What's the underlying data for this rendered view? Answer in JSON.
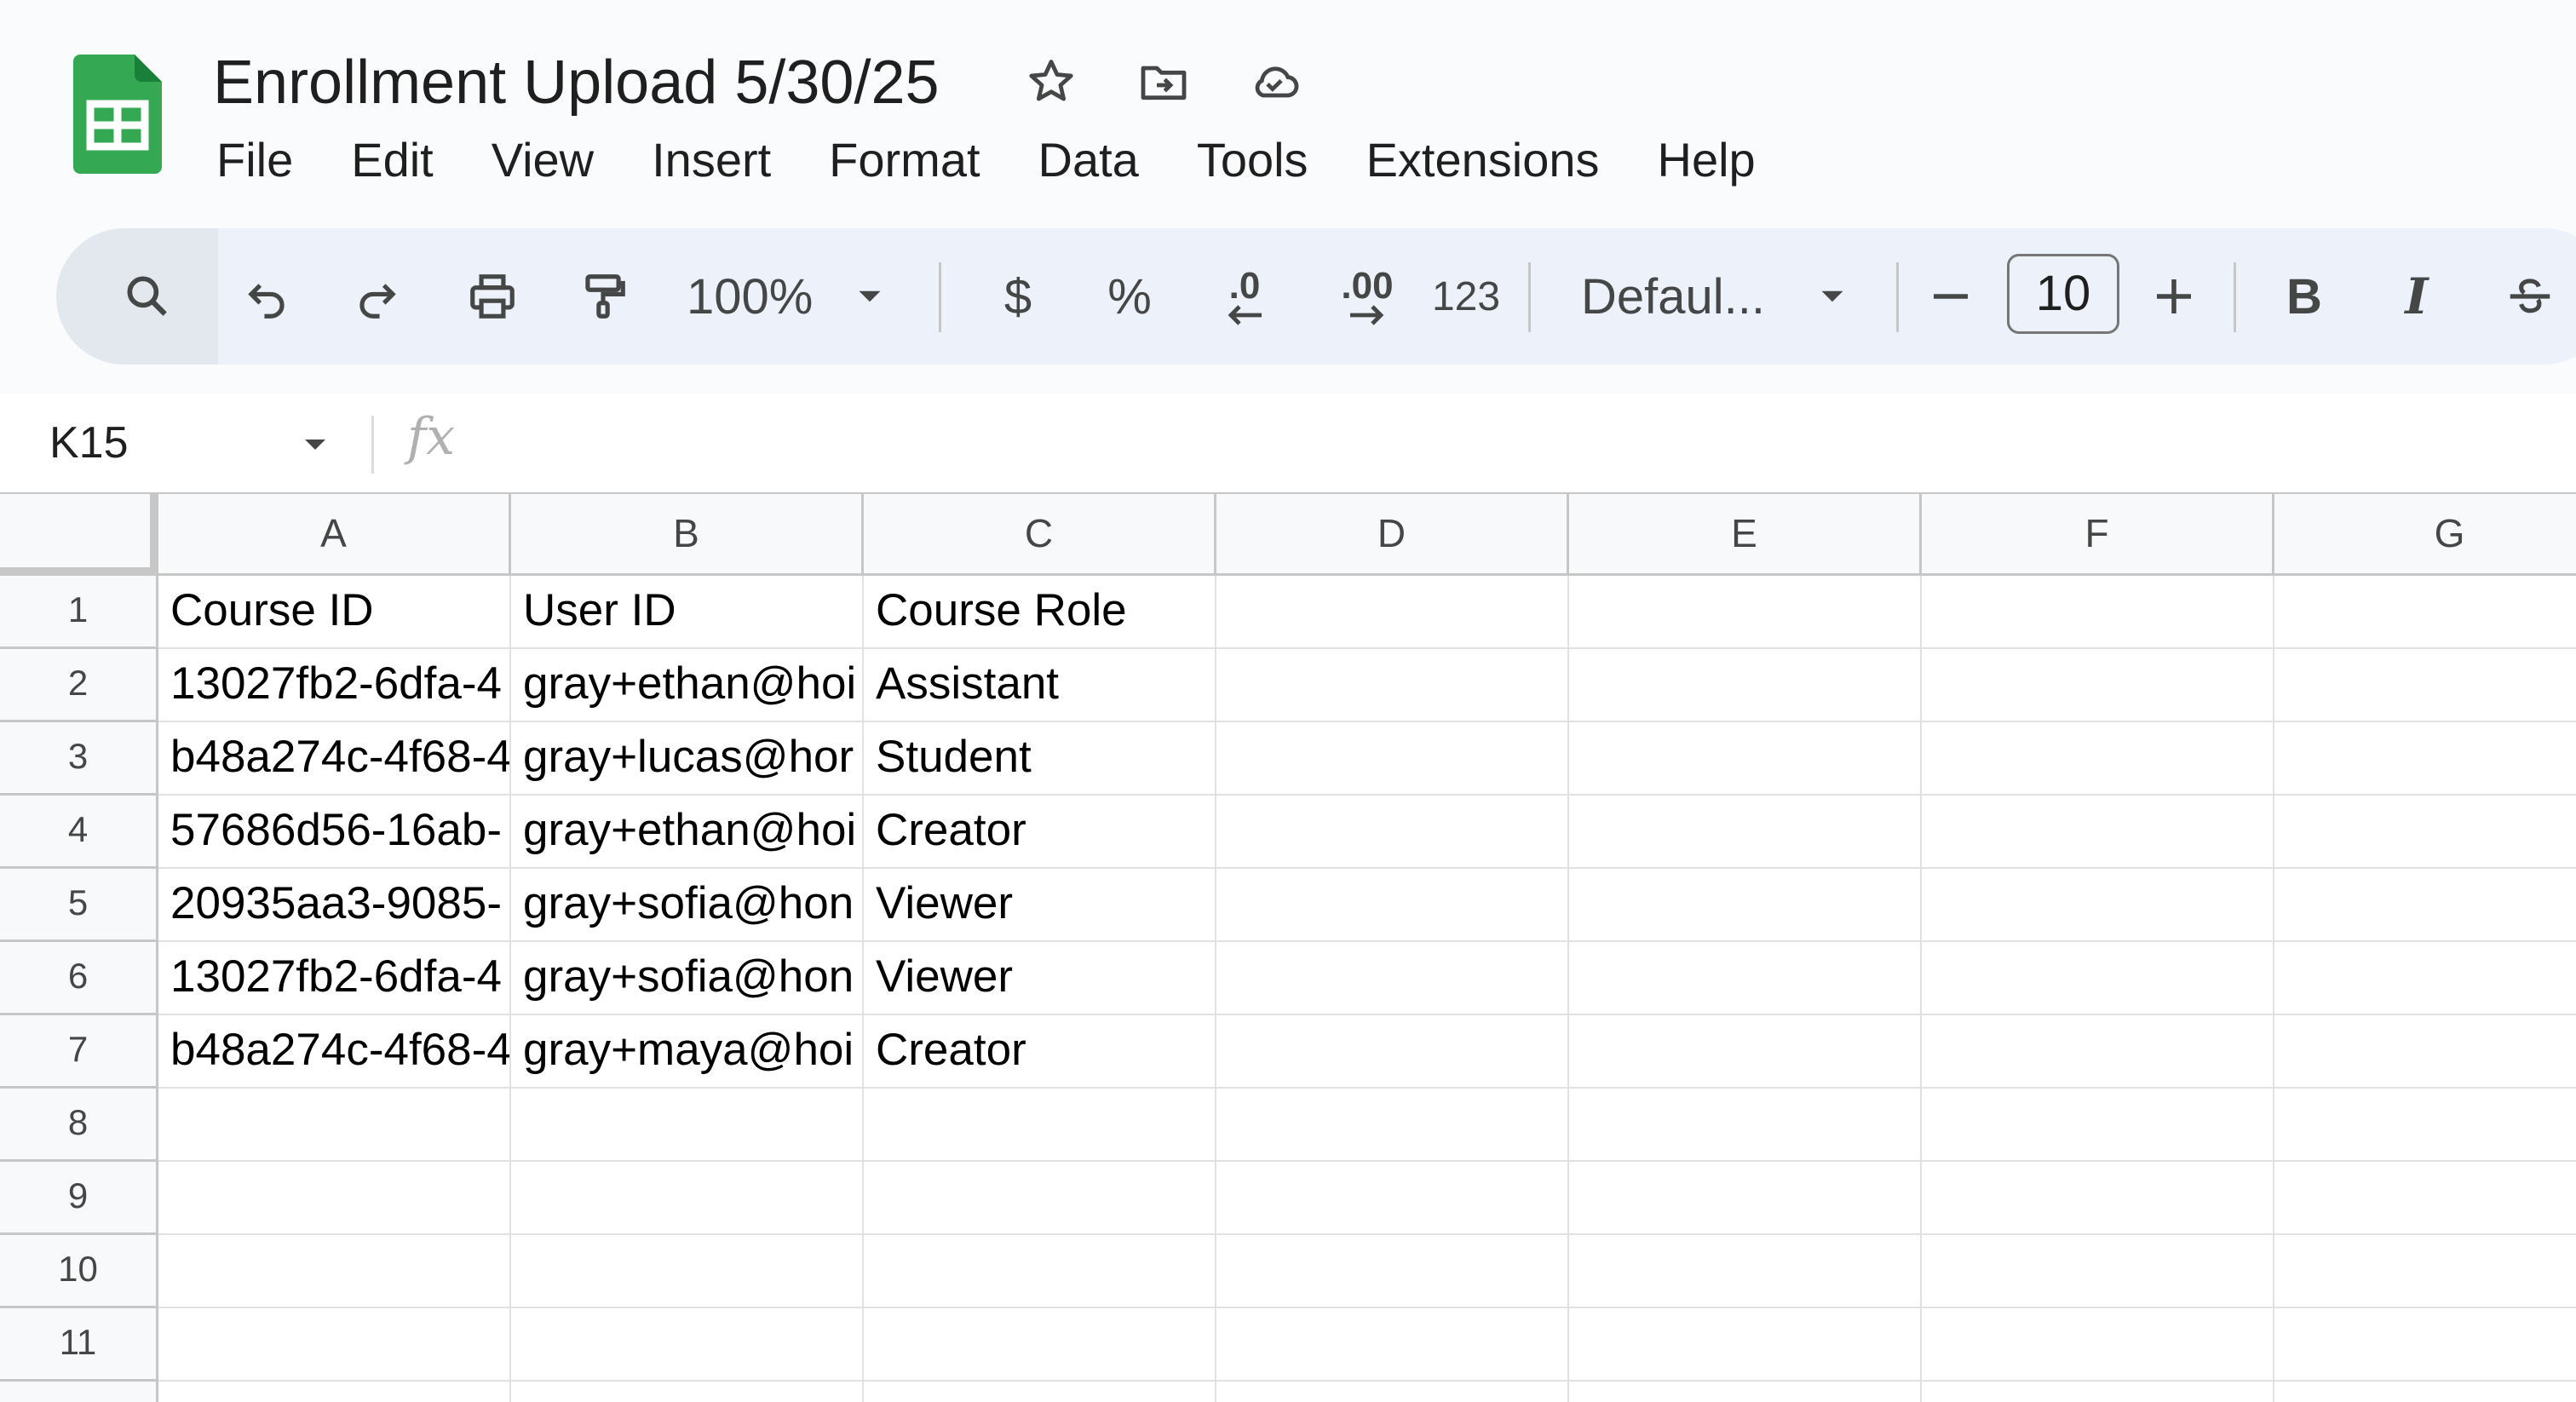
{
  "app": {
    "icon": "sheets-logo-icon"
  },
  "document": {
    "title": "Enrollment Upload 5/30/25"
  },
  "title_icons": [
    "star-icon",
    "move-folder-icon",
    "cloud-saved-icon"
  ],
  "menu": [
    "File",
    "Edit",
    "View",
    "Insert",
    "Format",
    "Data",
    "Tools",
    "Extensions",
    "Help"
  ],
  "toolbar": {
    "zoom": "100%",
    "currency": "$",
    "percent": "%",
    "decrease_decimal": ".0",
    "increase_decimal": ".00",
    "number_format": "123",
    "font": "Defaul...",
    "font_size": "10",
    "bold": "B",
    "italic": "I"
  },
  "formula_bar": {
    "cell_ref": "K15",
    "fx": "fx"
  },
  "sheet": {
    "columns": [
      "A",
      "B",
      "C",
      "D",
      "E",
      "F",
      "G"
    ],
    "row_numbers": [
      "1",
      "2",
      "3",
      "4",
      "5",
      "6",
      "7",
      "8",
      "9",
      "10",
      "11"
    ],
    "rows": [
      [
        "Course ID",
        "User ID",
        "Course Role"
      ],
      [
        "13027fb2-6dfa-4",
        "gray+ethan@hoi",
        "Assistant"
      ],
      [
        "b48a274c-4f68-4",
        "gray+lucas@hor",
        "Student"
      ],
      [
        "57686d56-16ab-",
        "gray+ethan@hoi",
        "Creator"
      ],
      [
        "20935aa3-9085-",
        "gray+sofia@hon",
        "Viewer"
      ],
      [
        "13027fb2-6dfa-4",
        "gray+sofia@hon",
        "Viewer"
      ],
      [
        "b48a274c-4f68-4",
        "gray+maya@hoi",
        "Creator"
      ]
    ]
  }
}
